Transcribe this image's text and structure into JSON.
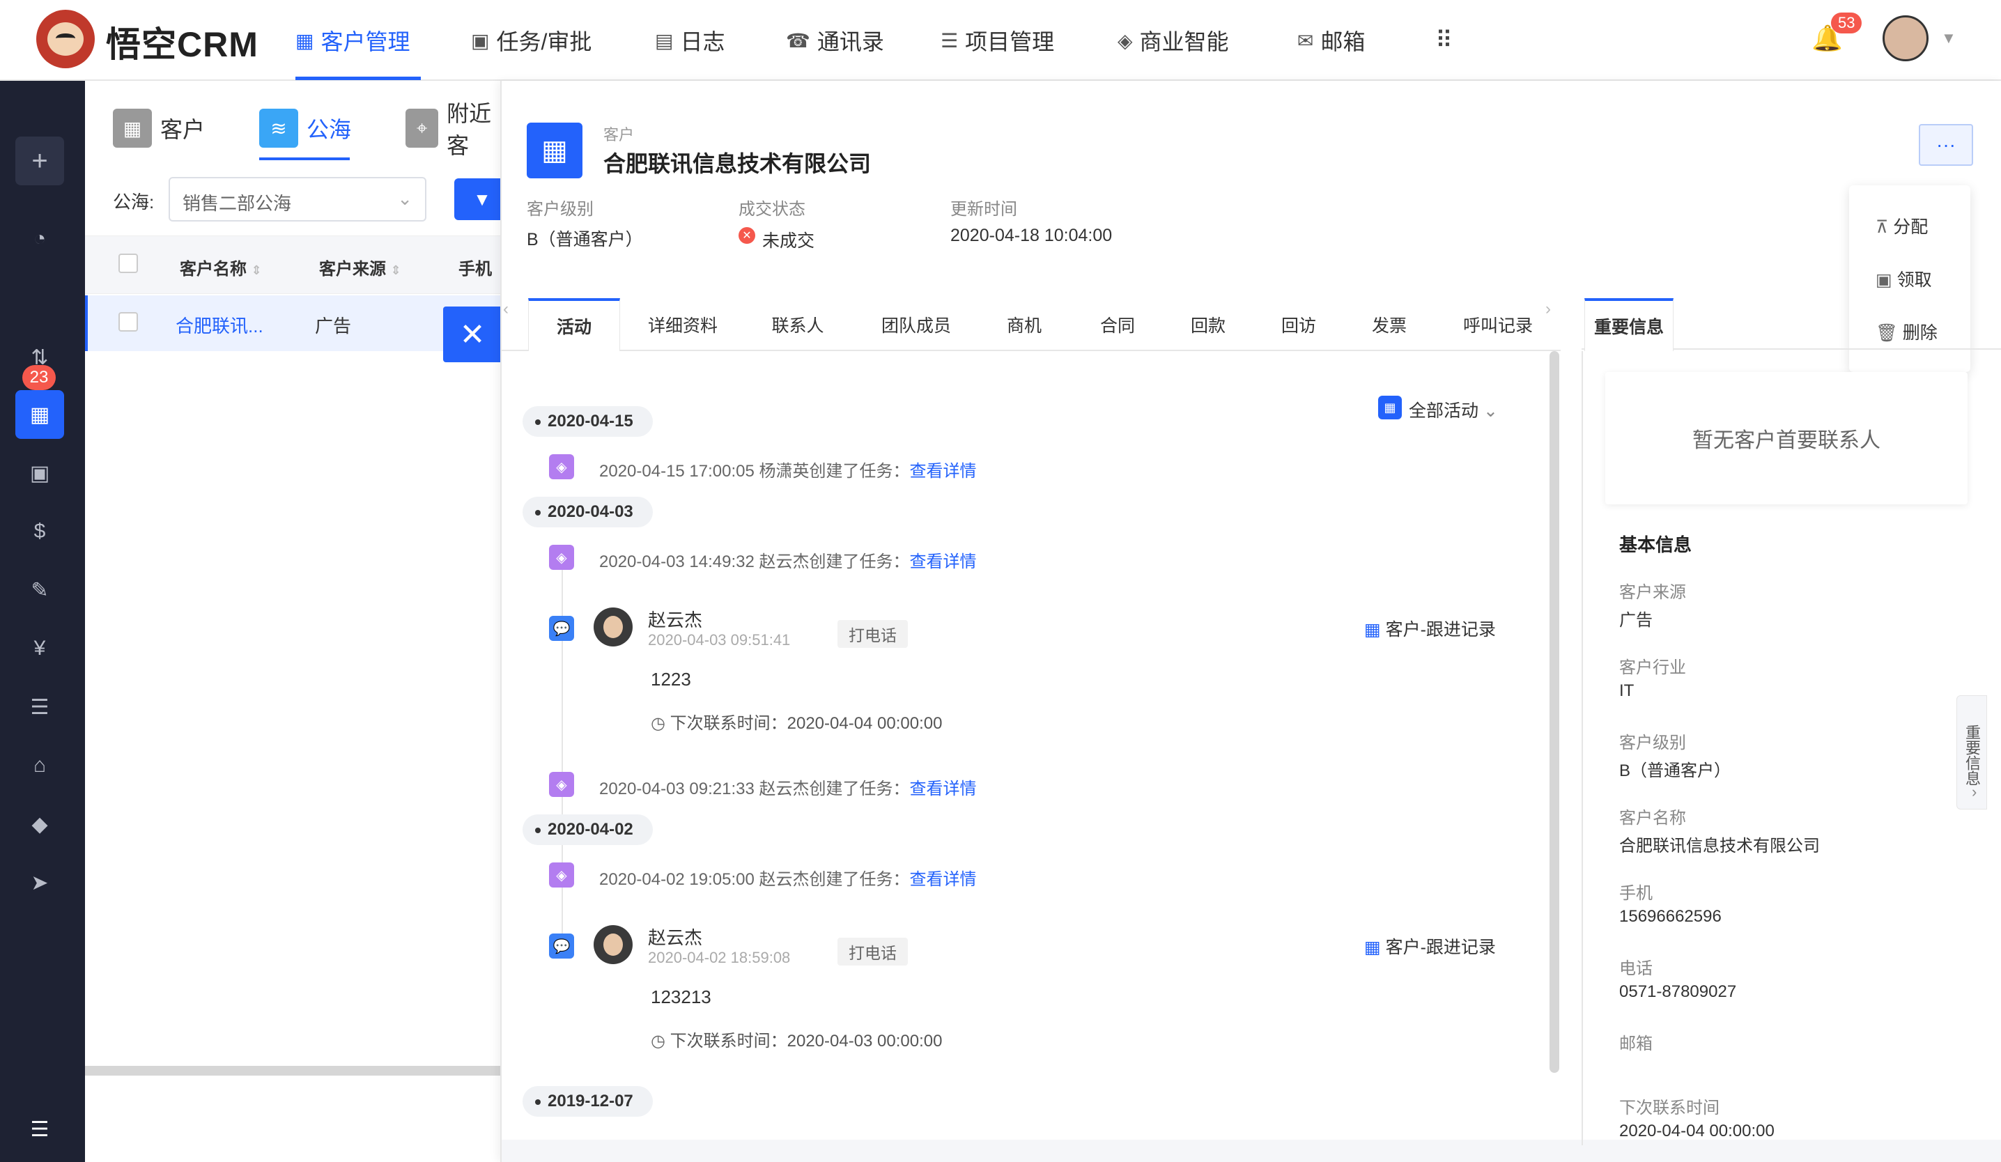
{
  "app": {
    "logo_text": "悟空CRM"
  },
  "topnav": {
    "items": [
      {
        "label": "客户管理",
        "icon": "building-icon"
      },
      {
        "label": "任务/审批",
        "icon": "briefcase-icon"
      },
      {
        "label": "日志",
        "icon": "note-icon"
      },
      {
        "label": "通讯录",
        "icon": "phonebook-icon"
      },
      {
        "label": "项目管理",
        "icon": "list-icon"
      },
      {
        "label": "商业智能",
        "icon": "shield-check-icon"
      },
      {
        "label": "邮箱",
        "icon": "envelope-icon"
      }
    ],
    "active": "客户管理",
    "notification_count": "53"
  },
  "sidebar": {
    "badge": "23"
  },
  "list": {
    "tabs": [
      "客户",
      "公海",
      "附近客"
    ],
    "active_tab": "公海",
    "pool_label": "公海:",
    "pool_value": "销售二部公海",
    "columns": [
      "客户名称",
      "客户来源",
      "手机"
    ],
    "rows": [
      {
        "name": "合肥联讯...",
        "source": "广告"
      }
    ]
  },
  "detail": {
    "type_label": "客户",
    "company": "合肥联讯信息技术有限公司",
    "meta": [
      {
        "label": "客户级别",
        "value": "B（普通客户）"
      },
      {
        "label": "成交状态",
        "value": "未成交"
      },
      {
        "label": "更新时间",
        "value": "2020-04-18 10:04:00"
      }
    ],
    "more_button": "···",
    "menu": [
      "分配",
      "领取",
      "删除"
    ],
    "tabs": [
      "活动",
      "详细资料",
      "联系人",
      "团队成员",
      "商机",
      "合同",
      "回款",
      "回访",
      "发票",
      "呼叫记录"
    ],
    "active_tab": "活动",
    "filter": "全部活动",
    "activity": {
      "d1": "2020-04-15",
      "t1": "2020-04-15 17:00:05 杨潇英创建了任务：",
      "d2": "2020-04-03",
      "t2": "2020-04-03 14:49:32 赵云杰创建了任务：",
      "f1_user": "赵云杰",
      "f1_time": "2020-04-03 09:51:41",
      "f1_tag": "打电话",
      "f1_type": "客户-跟进记录",
      "f1_content": "1223",
      "f1_next": "下次联系时间：2020-04-04 00:00:00",
      "t3": "2020-04-03 09:21:33 赵云杰创建了任务：",
      "d3": "2020-04-02",
      "t4": "2020-04-02 19:05:00 赵云杰创建了任务：",
      "f2_user": "赵云杰",
      "f2_time": "2020-04-02 18:59:08",
      "f2_tag": "打电话",
      "f2_type": "客户-跟进记录",
      "f2_content": "123213",
      "f2_next": "下次联系时间：2020-04-03 00:00:00",
      "d4": "2019-12-07",
      "link": "查看详情"
    }
  },
  "right": {
    "tab": "重要信息",
    "empty": "暂无客户首要联系人",
    "section": "基本信息",
    "fields": [
      {
        "label": "客户来源",
        "value": "广告"
      },
      {
        "label": "客户行业",
        "value": "IT"
      },
      {
        "label": "客户级别",
        "value": "B（普通客户）"
      },
      {
        "label": "客户名称",
        "value": "合肥联讯信息技术有限公司"
      },
      {
        "label": "手机",
        "value": "15696662596"
      },
      {
        "label": "电话",
        "value": "0571-87809027"
      },
      {
        "label": "邮箱",
        "value": ""
      },
      {
        "label": "下次联系时间",
        "value": "2020-04-04 00:00:00"
      }
    ],
    "side_tab": "重要信息"
  },
  "colors": {
    "accent": "#2362fb",
    "sidebar": "#1e2233",
    "badge": "#f5584c"
  }
}
